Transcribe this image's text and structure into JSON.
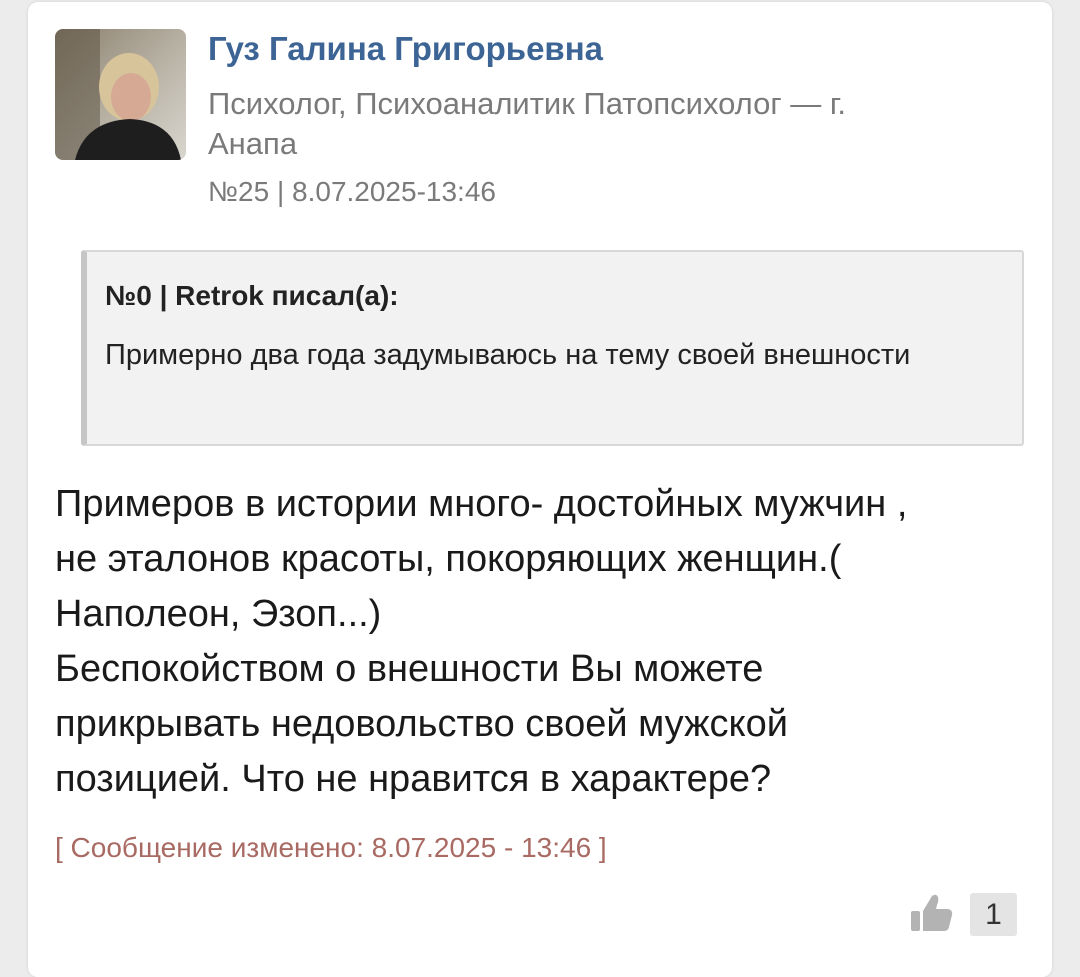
{
  "post": {
    "author_name": "Гуз Галина Григорьевна",
    "author_role": "Психолог, Психоаналитик Патопсихолог — г. Анапа",
    "meta": "№25 | 8.07.2025-13:46",
    "quote": {
      "header": "№0 | Retrok писал(а):",
      "text": "Примерно два года задумываюсь на тему своей внешности"
    },
    "body_lines": [
      "Примеров в истории много- достойных мужчин ,",
      "не эталонов красоты, покоряющих женщин.(",
      "Наполеон, Эзоп...)",
      "Беспокойством о внешности Вы можете",
      "прикрывать недовольство своей мужской",
      "позицией. Что не нравится в характере?"
    ],
    "edited_note": "[ Сообщение изменено: 8.07.2025 - 13:46 ]",
    "likes": {
      "icon": "thumbs-up-icon",
      "count": "1"
    }
  },
  "colors": {
    "author_link": "#3c6494",
    "meta_gray": "#7a7a7a",
    "edited_note": "#a86a62",
    "quote_bg": "#f2f2f2"
  }
}
